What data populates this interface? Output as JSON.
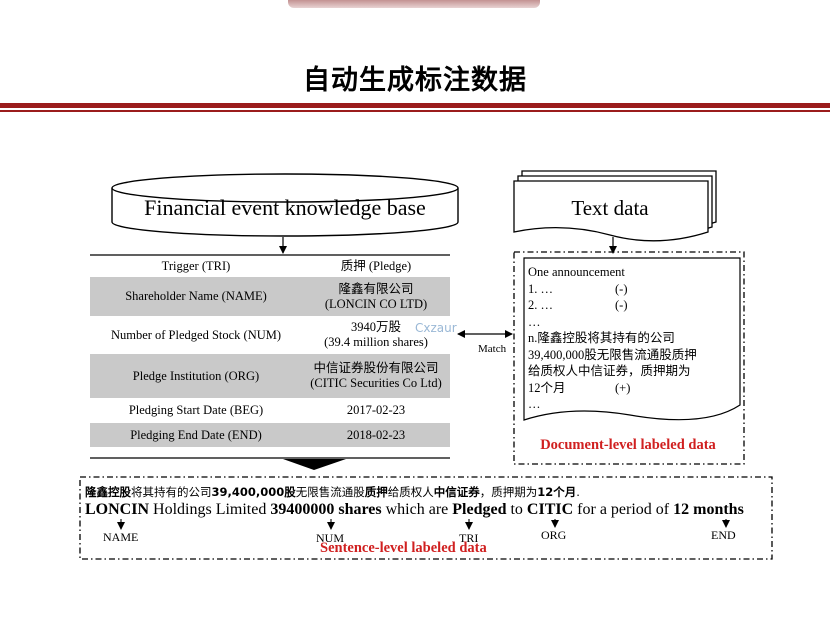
{
  "title": "自动生成标注数据",
  "kb": {
    "label": "Financial event knowledge base",
    "rows": [
      {
        "key": "Trigger  (TRI)",
        "value": "质押 (Pledge)",
        "shaded": false
      },
      {
        "key": "Shareholder Name (NAME)",
        "value": "隆鑫有限公司\n(LONCIN CO LTD)",
        "shaded": true
      },
      {
        "key": "Number of Pledged Stock (NUM)",
        "value": "3940万股\n(39.4 million shares)",
        "shaded": false
      },
      {
        "key": "Pledge Institution (ORG)",
        "value": "中信证券股份有限公司\n(CITIC Securities Co Ltd)",
        "shaded": true
      },
      {
        "key": "Pledging Start Date (BEG)",
        "value": "2017-02-23",
        "shaded": false
      },
      {
        "key": "Pledging End Date (END)",
        "value": "2018-02-23",
        "shaded": true
      }
    ]
  },
  "watermark": "Cxzaur",
  "match_label": "Match",
  "text_data": {
    "label": "Text data",
    "lines": [
      {
        "text": "One announcement",
        "mark": ""
      },
      {
        "text": "1. …",
        "mark": "(-)"
      },
      {
        "text": "2. …",
        "mark": "(-)"
      },
      {
        "text": "…",
        "mark": ""
      },
      {
        "text": "n.隆鑫控股将其持有的公司",
        "mark": ""
      },
      {
        "text": "39,400,000股无限售流通股质押",
        "mark": ""
      },
      {
        "text": "给质权人中信证券，质押期为",
        "mark": ""
      },
      {
        "text": "12个月",
        "mark": "(+)"
      },
      {
        "text": "…",
        "mark": ""
      }
    ],
    "caption": "Document-level labeled data"
  },
  "sentence": {
    "zh_parts": [
      {
        "text": "隆鑫控股",
        "bold": true
      },
      {
        "text": "将其持有的公司",
        "bold": false
      },
      {
        "text": "39,400,000股",
        "bold": true
      },
      {
        "text": "无限售流通股",
        "bold": false
      },
      {
        "text": "质押",
        "bold": true
      },
      {
        "text": "给质权人",
        "bold": false
      },
      {
        "text": "中信证券",
        "bold": true
      },
      {
        "text": "，质押期为",
        "bold": false
      },
      {
        "text": "12个月",
        "bold": true
      },
      {
        "text": ".",
        "bold": false
      }
    ],
    "en_parts": [
      {
        "text": "LONCIN",
        "bold": true
      },
      {
        "text": " Holdings Limited ",
        "bold": false
      },
      {
        "text": "39400000 shares",
        "bold": true
      },
      {
        "text": " which are ",
        "bold": false
      },
      {
        "text": "Pledged",
        "bold": true
      },
      {
        "text": " to ",
        "bold": false
      },
      {
        "text": "CITIC",
        "bold": true
      },
      {
        "text": " for a period of ",
        "bold": false
      },
      {
        "text": "12 months",
        "bold": true
      }
    ],
    "tags": {
      "name": "NAME",
      "num": "NUM",
      "tri": "TRI",
      "org": "ORG",
      "end": "END"
    },
    "caption": "Sentence-level labeled data"
  }
}
